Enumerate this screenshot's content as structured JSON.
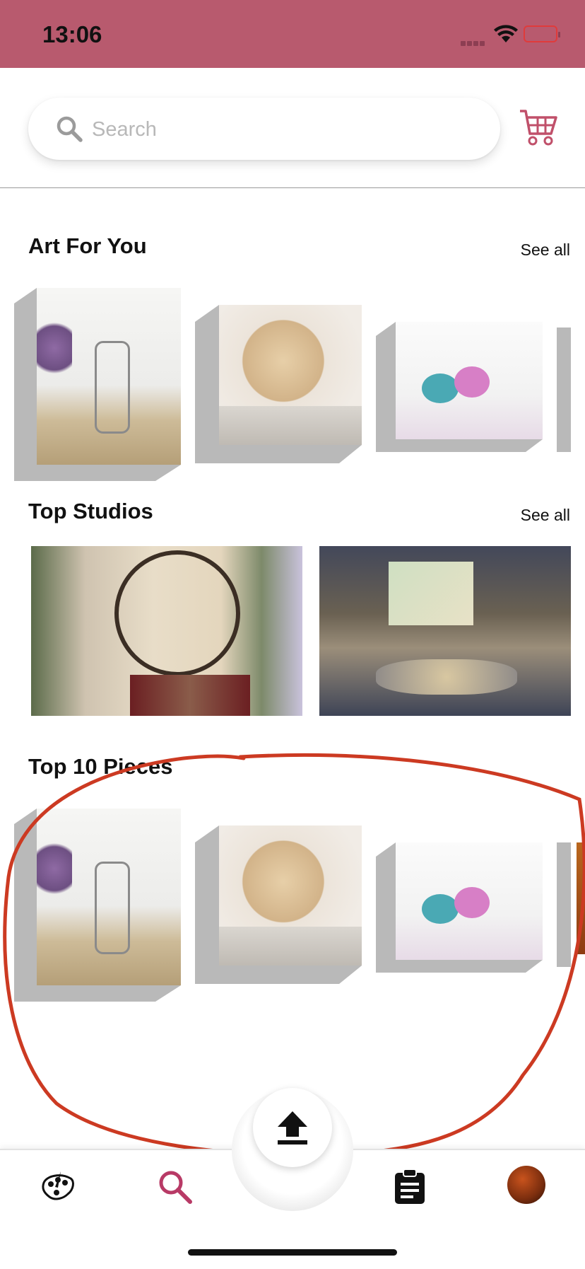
{
  "status_bar": {
    "time": "13:06",
    "background_color": "#b85a6e",
    "icons": [
      "cellular-signal-icon",
      "wifi-icon",
      "battery-low-icon"
    ]
  },
  "header": {
    "search_placeholder": "Search",
    "icons": [
      "search-icon",
      "cart-icon"
    ],
    "accent_color": "#c0506a"
  },
  "sections": {
    "art_for_you": {
      "title": "Art For You",
      "see_all": "See all",
      "items": [
        "vase-with-lavender",
        "plate-with-dried-flowers",
        "yarn-balls"
      ]
    },
    "top_studios": {
      "title": "Top Studios",
      "see_all": "See all",
      "items": [
        "studio-christmas-clock",
        "studio-painting-easel"
      ]
    },
    "top_10_pieces": {
      "title": "Top 10 Pieces",
      "items": [
        "vase-with-lavender",
        "plate-with-dried-flowers",
        "yarn-balls",
        "autumn-leaves"
      ]
    }
  },
  "bottom_nav": {
    "items": [
      {
        "name": "studio",
        "icon": "art-palette-icon"
      },
      {
        "name": "search",
        "icon": "search-icon",
        "active": true
      },
      {
        "name": "upload",
        "icon": "upload-icon"
      },
      {
        "name": "orders",
        "icon": "clipboard-icon"
      },
      {
        "name": "profile",
        "icon": "avatar"
      }
    ],
    "active_color": "#b83a66"
  },
  "annotation": {
    "color": "#cc3a22",
    "shape": "freehand-loop"
  }
}
